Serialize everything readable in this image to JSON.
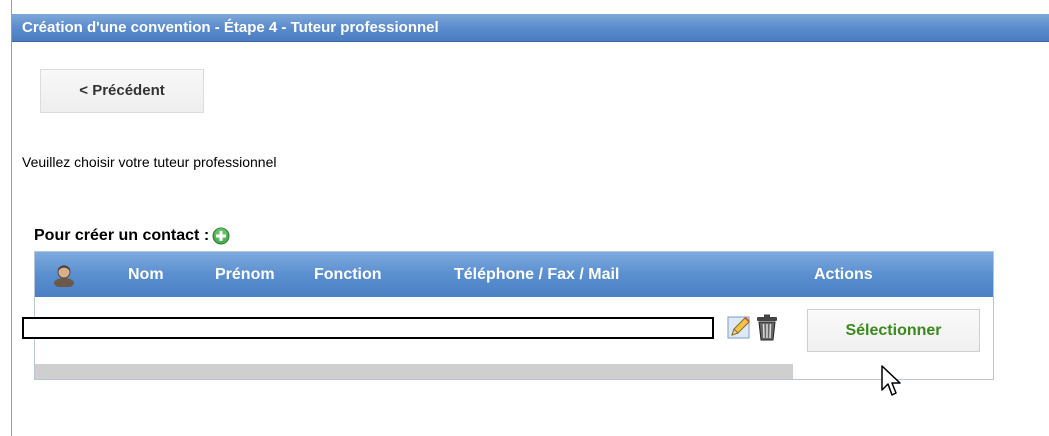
{
  "window": {
    "title": "Création d'une convention - Étape 4 - Tuteur professionnel"
  },
  "navigation": {
    "previous_label": "< Précédent"
  },
  "instruction": "Veuillez choisir votre tuteur professionnel",
  "create_contact": {
    "label": "Pour créer un contact :",
    "icon": "add-circle-icon"
  },
  "grid": {
    "columns": [
      {
        "label": "",
        "icon": "user-icon"
      },
      {
        "label": "Nom"
      },
      {
        "label": "Prénom"
      },
      {
        "label": "Fonction"
      },
      {
        "label": "Téléphone / Fax / Mail"
      },
      {
        "label": "Actions"
      }
    ],
    "rows": [
      {
        "value": "",
        "actions": {
          "edit_icon": "edit-pencil-icon",
          "delete_icon": "trash-icon",
          "select_label": "Sélectionner"
        }
      }
    ]
  },
  "colors": {
    "header_blue": "#5b8ccd",
    "select_green": "#3a8a1c",
    "add_green": "#4caf50"
  }
}
